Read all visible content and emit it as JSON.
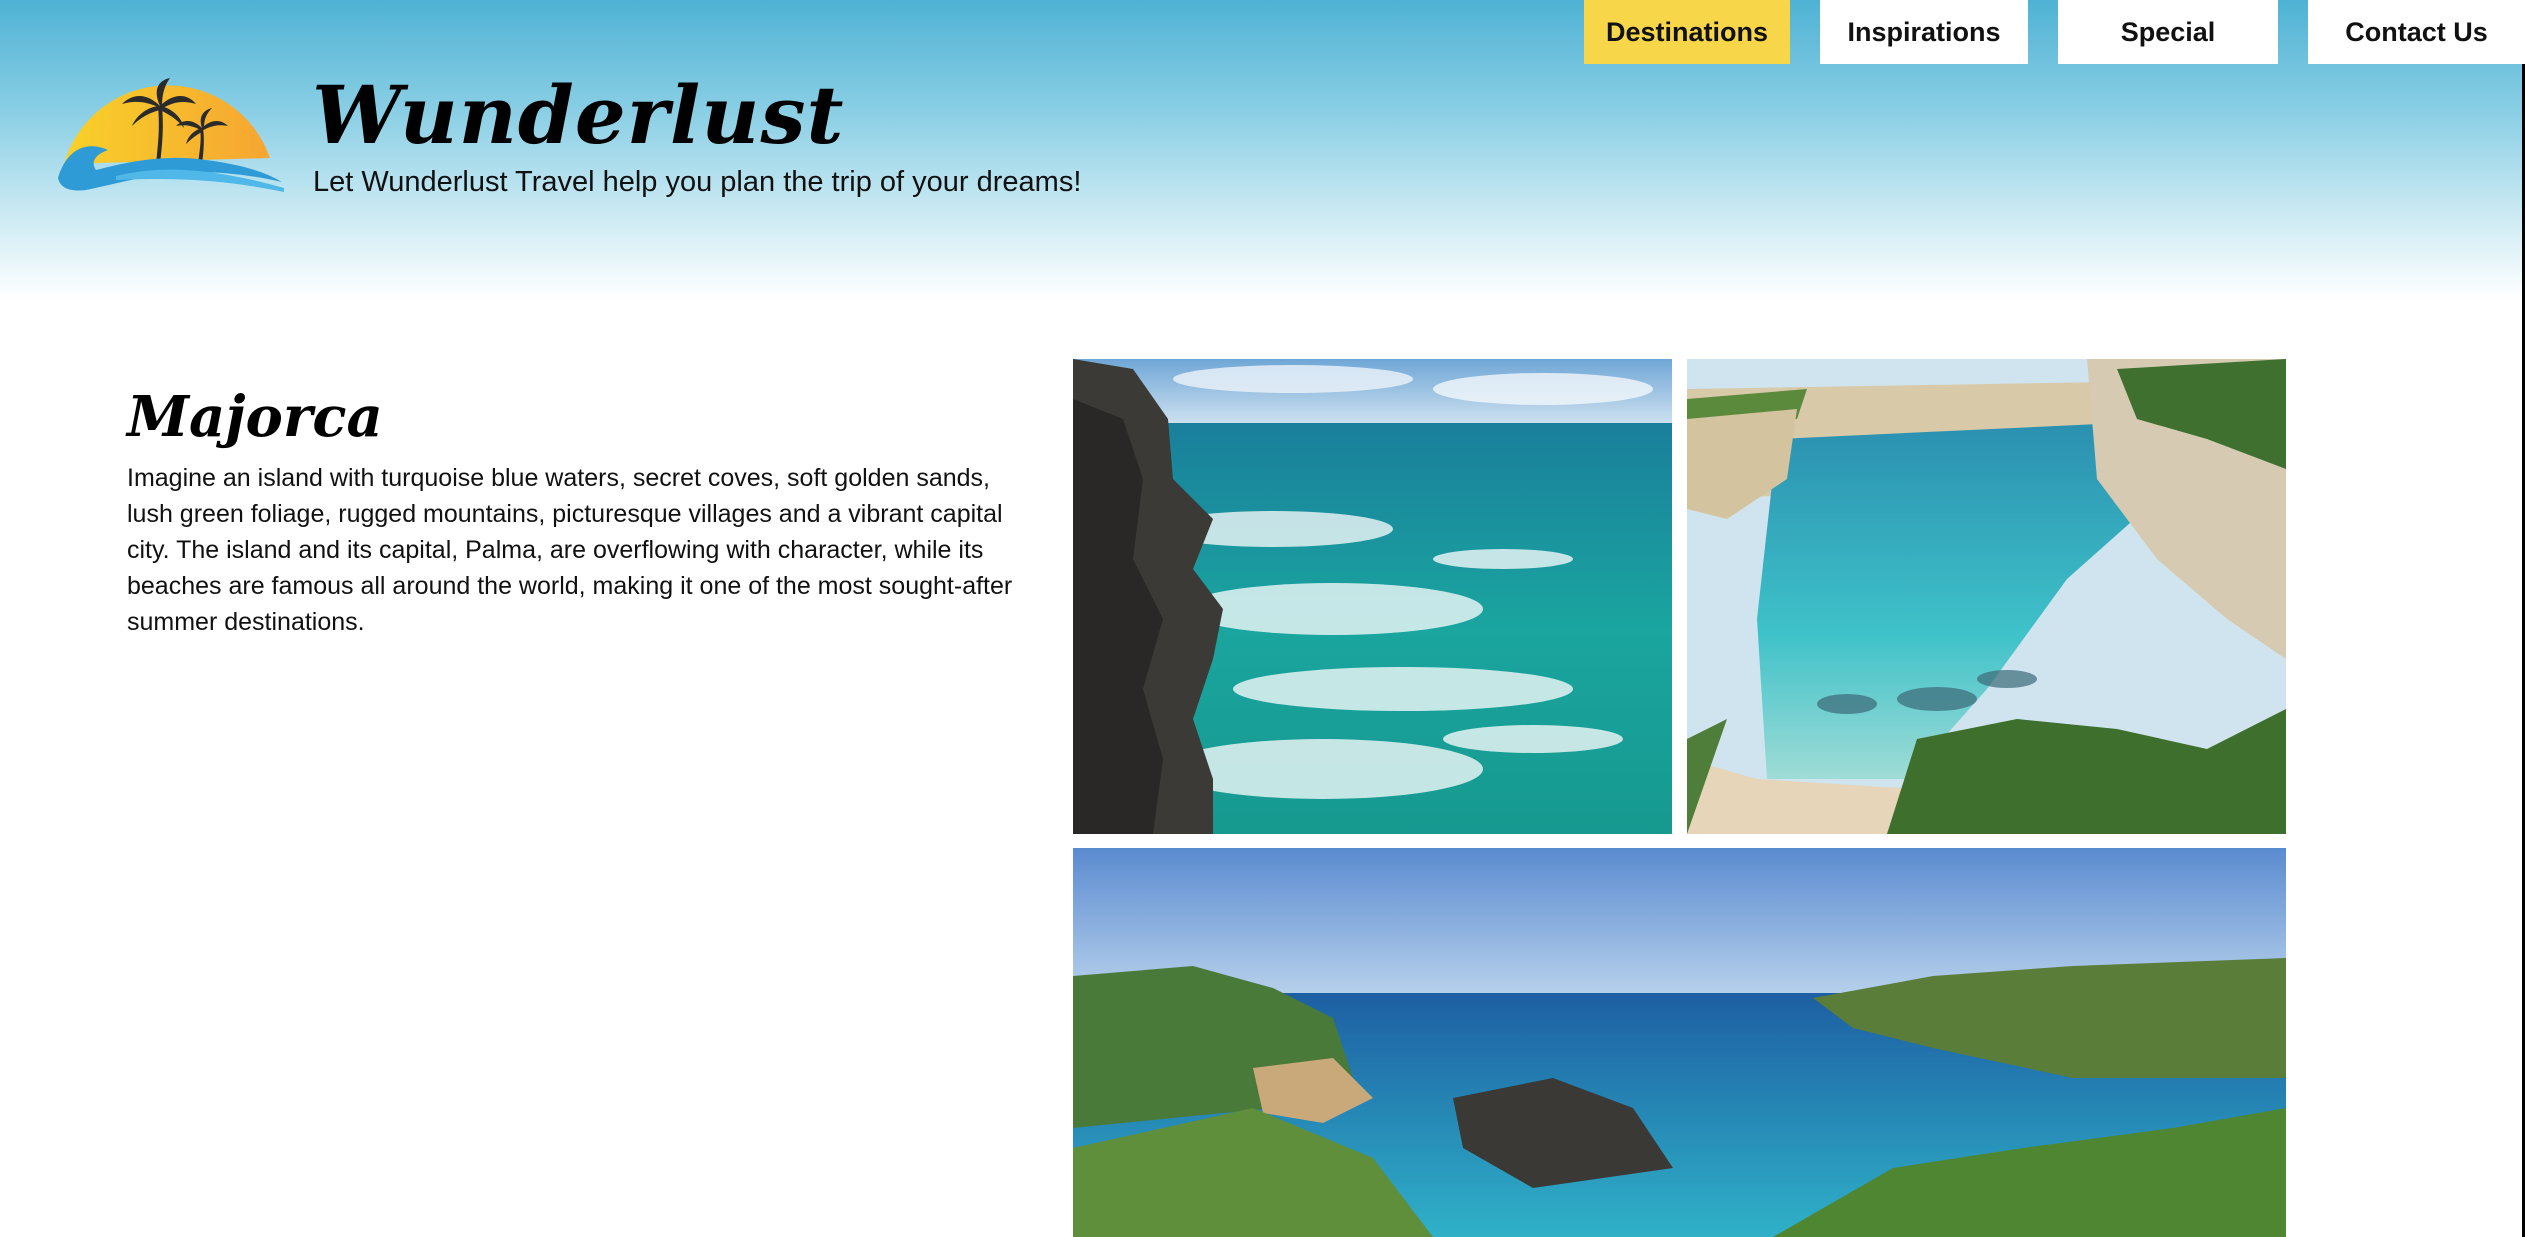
{
  "brand": {
    "name": "Wunderlust",
    "tagline": "Let Wunderlust Travel help you plan the trip of your dreams!",
    "logo_icon": "palm-sunset-wave-logo"
  },
  "nav": {
    "items": [
      {
        "label": "Destinations",
        "active": true
      },
      {
        "label": "Inspirations",
        "active": false
      },
      {
        "label": "Special",
        "active": false
      },
      {
        "label": "Contact Us",
        "active": false
      }
    ]
  },
  "section": {
    "title": "Majorca",
    "body": "Imagine an island with turquoise blue waters, secret coves, soft golden sands, lush green foliage, rugged mountains, picturesque villages and a vibrant capital city. The island and its capital, Palma, are overflowing with character, while its beaches are famous all around the world, making it one of the most sought-after summer destinations."
  },
  "colors": {
    "header_top": "#4fb2d4",
    "nav_active": "#f7d64a",
    "nav_default": "#ffffff",
    "sun": "#f9b233",
    "wave": "#2e9bd6"
  }
}
